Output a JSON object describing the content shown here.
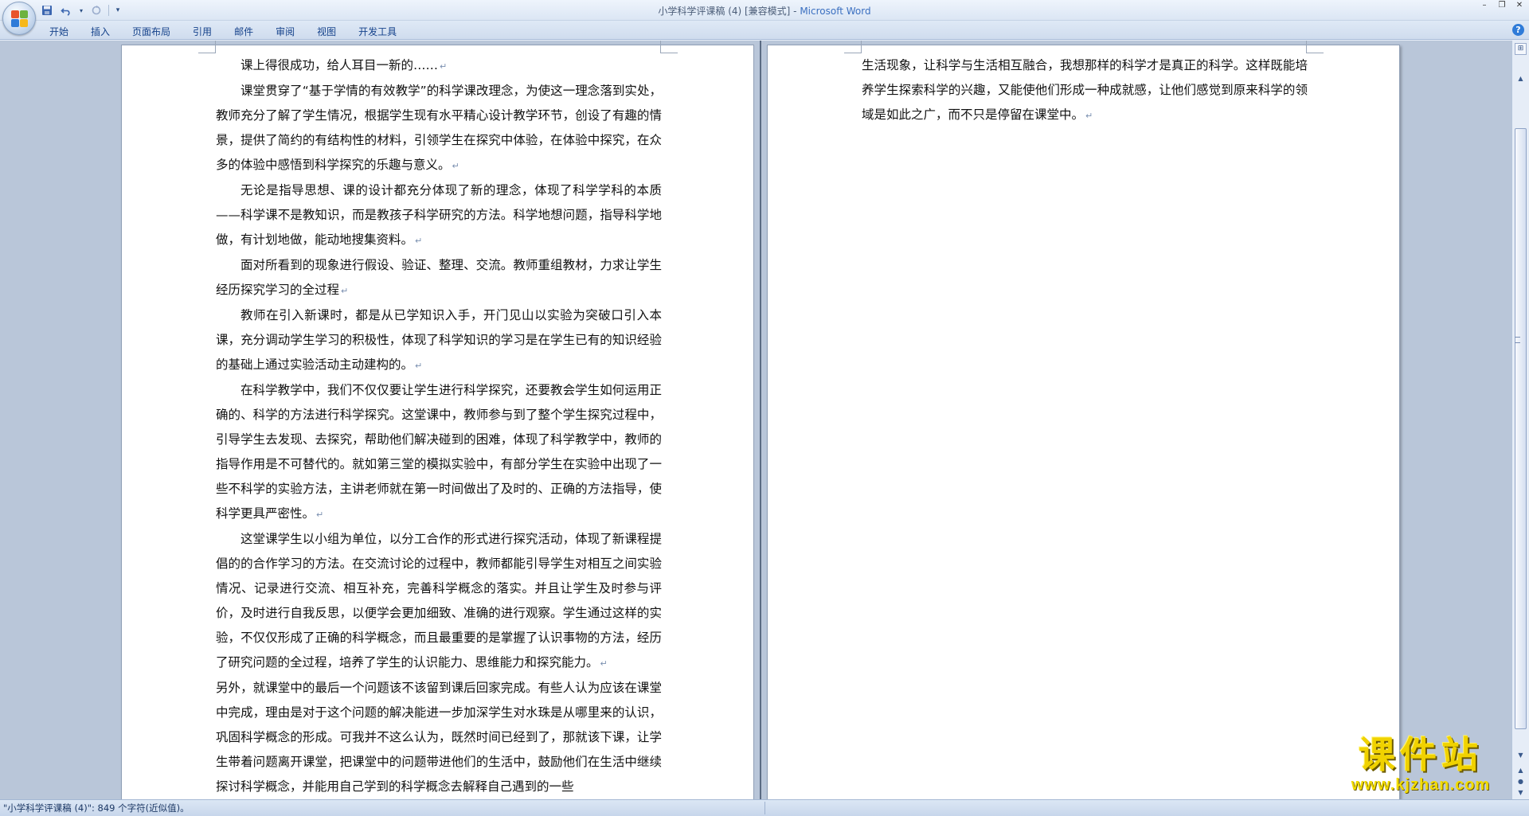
{
  "window": {
    "title_doc": "小学科学评课稿 (4) [兼容模式] - ",
    "title_app": "Microsoft Word"
  },
  "qat": {
    "save_icon": "save-icon",
    "undo_icon": "undo-icon",
    "redo_icon": "redo-icon",
    "customize_icon": "customize-qat-icon"
  },
  "ribbon": {
    "tabs": [
      "开始",
      "插入",
      "页面布局",
      "引用",
      "邮件",
      "审阅",
      "视图",
      "开发工具"
    ]
  },
  "left_page": {
    "paragraphs": [
      {
        "text": "课上得很成功，给人耳目一新的……",
        "indent": true
      },
      {
        "text": "课堂贯穿了“基于学情的有效教学”的科学课改理念，为使这一理念落到实处，教师充分了解了学生情况，根据学生现有水平精心设计教学环节，创设了有趣的情景，提供了简约的有结构性的材料，引领学生在探究中体验，在体验中探究，在众多的体验中感悟到科学探究的乐趣与意义。",
        "indent": true
      },
      {
        "text": "无论是指导思想、课的设计都充分体现了新的理念，体现了科学学科的本质——科学课不是教知识，而是教孩子科学研究的方法。科学地想问题，指导科学地做，有计划地做，能动地搜集资料。",
        "indent": true
      },
      {
        "text": "面对所看到的现象进行假设、验证、整理、交流。教师重组教材，力求让学生经历探究学习的全过程",
        "indent": true
      },
      {
        "text": " 教师在引入新课时，都是从已学知识入手，开门见山以实验为突破口引入本课，充分调动学生学习的积极性，体现了科学知识的学习是在学生已有的知识经验的基础上通过实验活动主动建构的。",
        "indent": true
      },
      {
        "text": "在科学教学中，我们不仅仅要让学生进行科学探究，还要教会学生如何运用正确的、科学的方法进行科学探究。这堂课中，教师参与到了整个学生探究过程中，引导学生去发现、去探究，帮助他们解决碰到的困难，体现了科学教学中，教师的指导作用是不可替代的。就如第三堂的模拟实验中，有部分学生在实验中出现了一些不科学的实验方法，主讲老师就在第一时间做出了及时的、正确的方法指导，使科学更具严密性。",
        "indent": true
      },
      {
        "text": "这堂课学生以小组为单位，以分工合作的形式进行探究活动，体现了新课程提倡的的合作学习的方法。在交流讨论的过程中，教师都能引导学生对相互之间实验情况、记录进行交流、相互补充，完善科学概念的落实。并且让学生及时参与评价，及时进行自我反思，以便学会更加细致、准确的进行观察。学生通过这样的实验，不仅仅形成了正确的科学概念，而且最重要的是掌握了认识事物的方法，经历了研究问题的全过程，培养了学生的认识能力、思维能力和探究能力。",
        "indent": true
      },
      {
        "text": "另外，就课堂中的最后一个问题该不该留到课后回家完成。有些人认为应该在课堂中完成，理由是对于这个问题的解决能进一步加深学生对水珠是从哪里来的认识，巩固科学概念的形成。可我并不这么认为，既然时间已经到了，那就该下课，让学生带着问题离开课堂，把课堂中的问题带进他们的生活中，鼓励他们在生活中继续探讨科学概念，并能用自己学到的科学概念去解释自己遇到的一些",
        "indent": false
      }
    ]
  },
  "right_page": {
    "paragraphs": [
      {
        "text": "生活现象，让科学与生活相互融合，我想那样的科学才是真正的科学。这样既能培养学生探索科学的兴趣，又能使他们形成一种成就感，让他们感觉到原来科学的领域是如此之广，而不只是停留在课堂中。",
        "indent": false
      }
    ]
  },
  "pilcrow": "↵",
  "statusbar": {
    "text": "\"小学科学评课稿 (4)\": 849 个字符(近似值)。"
  },
  "watermark": {
    "cn": "课件站",
    "url": "www.kjzhan.com"
  },
  "colors": {
    "accent": "#15428b",
    "app_title": "#3a6fc0",
    "watermark": "#f0d200"
  }
}
